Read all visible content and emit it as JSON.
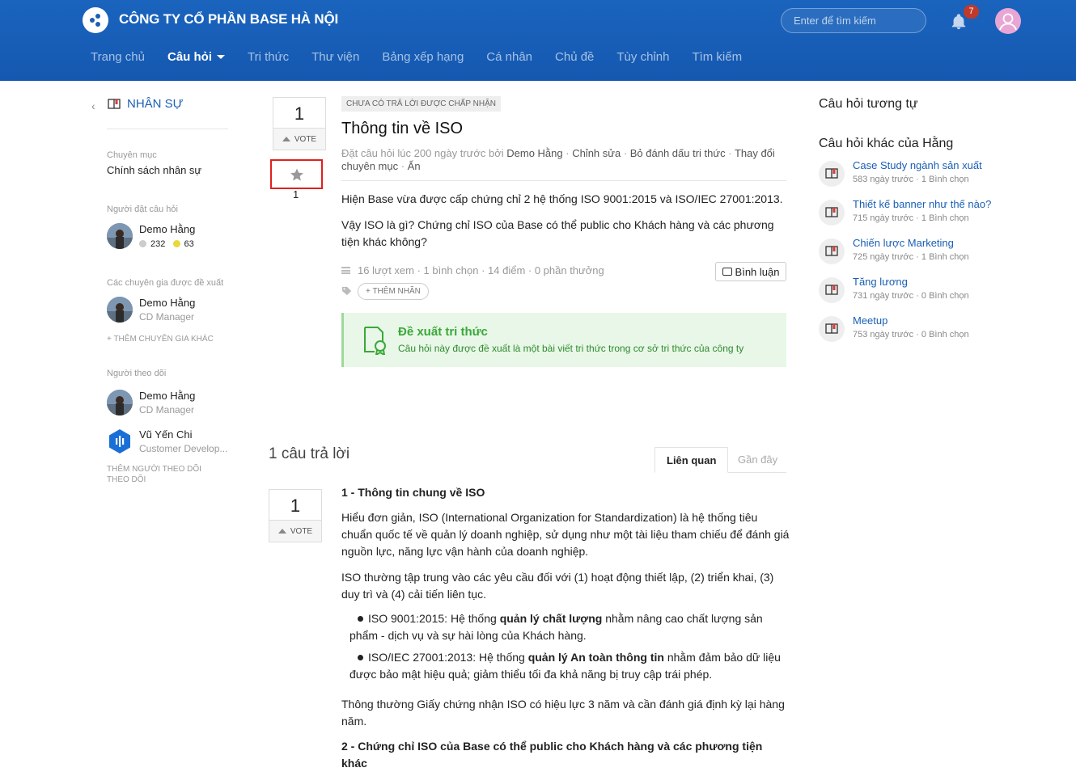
{
  "header": {
    "company": "CÔNG TY CỔ PHẦN BASE HÀ NỘI",
    "search_placeholder": "Enter để tìm kiếm",
    "notification_count": "7",
    "nav": [
      {
        "label": "Trang chủ",
        "active": false
      },
      {
        "label": "Câu hỏi",
        "active": true
      },
      {
        "label": "Tri thức",
        "active": false
      },
      {
        "label": "Thư viện",
        "active": false
      },
      {
        "label": "Bảng xếp hạng",
        "active": false
      },
      {
        "label": "Cá nhân",
        "active": false
      },
      {
        "label": "Chủ đề",
        "active": false
      },
      {
        "label": "Tùy chỉnh",
        "active": false
      },
      {
        "label": "Tìm kiếm",
        "active": false
      }
    ]
  },
  "sidebar": {
    "category_title": "NHÂN SỰ",
    "category_label": "Chuyên mục",
    "category_value": "Chính sách nhân sự",
    "asker_label": "Người đặt câu hỏi",
    "asker": {
      "name": "Demo Hằng",
      "stat1": "232",
      "stat2": "63"
    },
    "experts_label": "Các chuyên gia được đề xuất",
    "expert": {
      "name": "Demo Hằng",
      "role": "CD Manager"
    },
    "add_expert": "+ THÊM CHUYÊN GIA KHÁC",
    "followers_label": "Người theo dõi",
    "followers": [
      {
        "name": "Demo Hằng",
        "role": "CD Manager"
      },
      {
        "name": "Vũ Yến Chi",
        "role": "Customer Develop..."
      }
    ],
    "add_follower_1": "THÊM NGƯỜI THEO DÕI",
    "add_follower_2": "THEO DÕI"
  },
  "question": {
    "votes": "1",
    "vote_label": "VOTE",
    "star_count": "1",
    "status": "CHƯA CÓ TRẢ LỜI ĐƯỢC CHẤP NHẬN",
    "title": "Thông tin về ISO",
    "meta_prefix": "Đặt câu hỏi lúc 200 ngày trước bởi ",
    "meta_author": "Demo Hằng",
    "meta_actions": [
      " · ",
      "Chỉnh sửa",
      " · ",
      "Bỏ đánh dấu tri thức",
      " · ",
      "Thay đổi chuyên mục",
      " · ",
      "Ẩn"
    ],
    "body_1": "Hiện Base vừa được cấp chứng chỉ 2 hệ thống ISO 9001:2015 và ISO/IEC 27001:2013.",
    "body_2": "Vậy ISO là gì? Chứng chỉ ISO của Base có thể public cho Khách hàng và các phương tiện khác không?",
    "stats": "16 lượt xem · 1 bình chọn · 14 điểm · 0 phần thưởng",
    "comment_button": "Bình luận",
    "add_tag": "+ THÊM NHÃN",
    "suggest_title": "Đề xuất tri thức",
    "suggest_text": "Câu hỏi này được đề xuất là một bài viết tri thức trong cơ sở tri thức của công ty"
  },
  "answers": {
    "count_label": "1 câu trả lời",
    "tab_related": "Liên quan",
    "tab_recent": "Gần đây",
    "votes": "1",
    "vote_label": "VOTE",
    "heading_1": "1 - Thông tin chung về ISO",
    "para_1": "Hiểu đơn giản, ISO (International Organization for Standardization) là hệ thống tiêu chuẩn quốc tế về quản lý doanh nghiệp, sử dụng như một tài liệu tham chiếu để đánh giá nguồn lực, năng lực vận hành của doanh nghiệp.",
    "para_2": "ISO thường tập trung vào các yêu cầu đối với (1) hoạt động thiết lập, (2) triển khai, (3) duy trì và (4) cải tiến liên tục.",
    "bullet_1_a": "ISO 9001:2015: Hệ thống ",
    "bullet_1_b": "quản lý chất lượng",
    "bullet_1_c": " nhằm nâng cao chất lượng sản phẩm - dịch vụ và sự hài lòng của Khách hàng.",
    "bullet_2_a": "ISO/IEC 27001:2013: Hệ thống ",
    "bullet_2_b": "quản lý An toàn thông tin",
    "bullet_2_c": " nhằm đảm bảo dữ liệu được bảo mật hiệu quả; giảm thiểu tối đa khả năng bị truy cập trái phép.",
    "para_3": "Thông thường Giấy chứng nhận ISO có hiệu lực 3 năm và cần đánh giá định kỳ lại hàng năm.",
    "heading_2": "2 - Chứng chỉ ISO của Base có thể public cho Khách hàng và các phương tiện khác"
  },
  "right": {
    "similar_title": "Câu hỏi tương tự",
    "other_title": "Câu hỏi khác của Hằng",
    "items": [
      {
        "title": "Case Study ngành sản xuất",
        "meta": "583 ngày trước · 1 Bình chọn"
      },
      {
        "title": "Thiết kế banner như thế nào?",
        "meta": "715 ngày trước · 1 Bình chọn"
      },
      {
        "title": "Chiến lược Marketing",
        "meta": "725 ngày trước · 1 Bình chọn"
      },
      {
        "title": "Tăng lương",
        "meta": "731 ngày trước · 0 Bình chọn"
      },
      {
        "title": "Meetup",
        "meta": "753 ngày trước · 0 Bình chọn"
      }
    ]
  },
  "colors": {
    "header_blue": "#1a64be",
    "link_blue": "#1a5fb4",
    "success_green": "#3aa83a",
    "highlight_red": "#e02020"
  }
}
